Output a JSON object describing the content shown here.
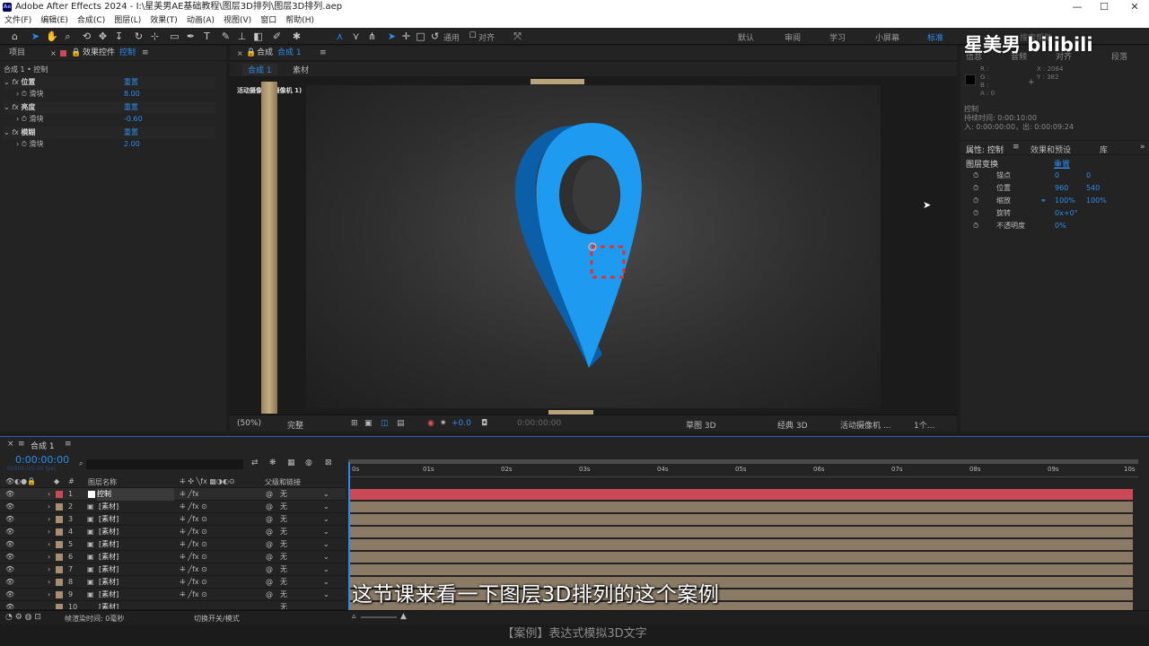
{
  "window": {
    "app_icon": "Ae",
    "title": "Adobe After Effects 2024 - I:\\星美男AE基础教程\\图层3D排列\\图层3D排列.aep",
    "minimize": "—",
    "maximize": "☐",
    "close": "✕"
  },
  "menu": [
    "文件(F)",
    "编辑(E)",
    "合成(C)",
    "图层(L)",
    "效果(T)",
    "动画(A)",
    "视图(V)",
    "窗口",
    "帮助(H)"
  ],
  "toolbar": {
    "align_label": "通用",
    "snap_label": "对齐",
    "workspaces": [
      "默认",
      "审阅",
      "学习",
      "小屏幕",
      "标准"
    ],
    "active_workspace": "标准",
    "search_placeholder": "搜索帮助"
  },
  "left_panel": {
    "tab_project": "项目",
    "tab_effects": "效果控件",
    "tab_effects_target": "控制",
    "breadcrumb": "合成 1 • 控制",
    "effects": [
      {
        "name": "位置",
        "reset": "重置",
        "param": "滑块",
        "value": "8.00"
      },
      {
        "name": "亮度",
        "reset": "重置",
        "param": "滑块",
        "value": "-0.60"
      },
      {
        "name": "模糊",
        "reset": "重置",
        "param": "滑块",
        "value": "2.00"
      }
    ]
  },
  "viewer": {
    "tab_label": "合成",
    "tab_comp": "合成 1",
    "sub_tabs": [
      "合成 1",
      "素材"
    ],
    "camera_label": "活动摄像机 (摄像机 1)",
    "zoom": "(50%)",
    "quality": "完整",
    "exposure": "+0.0",
    "timecode": "0:00:00:00",
    "draft3d": "草图 3D",
    "renderer": "经典 3D",
    "camera_view": "活动摄像机 ...",
    "views": "1个..."
  },
  "right_panel": {
    "info_tabs": [
      "信息",
      "音频",
      "对齐",
      "段落"
    ],
    "rgb": [
      "R :",
      "G :",
      "B :",
      "A : 0"
    ],
    "cursor_x": "X : 2064",
    "cursor_y": "Y : 382",
    "layer_name": "控制",
    "duration": "持续时间: 0:00:10:00",
    "in_out": "入: 0:00:00:00，出: 0:00:09:24",
    "props_tab": "属性: 控制",
    "effects_presets_tab": "效果和预设",
    "library_tab": "库",
    "transform_label": "图层变换",
    "transform_reset": "重置",
    "props": [
      {
        "name": "锚点",
        "v1": "0",
        "v2": "0"
      },
      {
        "name": "位置",
        "v1": "960",
        "v2": "540"
      },
      {
        "name": "缩放",
        "v1": "100%",
        "v2": "100%"
      },
      {
        "name": "旋转",
        "v1": "0x+0°",
        "v2": ""
      },
      {
        "name": "不透明度",
        "v1": "0%",
        "v2": ""
      }
    ]
  },
  "timeline": {
    "tab": "合成 1",
    "timecode": "0:00:00:00",
    "timecode_sub": "00000 (25.00 fps)",
    "search_placeholder": "",
    "col_num": "#",
    "col_name": "图层名称",
    "col_parent": "父级和链接",
    "ruler": [
      "0s",
      "01s",
      "02s",
      "03s",
      "04s",
      "05s",
      "06s",
      "07s",
      "08s",
      "09s",
      "10s"
    ],
    "layers": [
      {
        "num": "1",
        "name": "控制",
        "parent": "无",
        "color": "#c94a55"
      },
      {
        "num": "2",
        "name": "[素材]",
        "parent": "无",
        "color": "#a88f72"
      },
      {
        "num": "3",
        "name": "[素材]",
        "parent": "无",
        "color": "#a88f72"
      },
      {
        "num": "4",
        "name": "[素材]",
        "parent": "无",
        "color": "#a88f72"
      },
      {
        "num": "5",
        "name": "[素材]",
        "parent": "无",
        "color": "#a88f72"
      },
      {
        "num": "6",
        "name": "[素材]",
        "parent": "无",
        "color": "#a88f72"
      },
      {
        "num": "7",
        "name": "[素材]",
        "parent": "无",
        "color": "#a88f72"
      },
      {
        "num": "8",
        "name": "[素材]",
        "parent": "无",
        "color": "#a88f72"
      },
      {
        "num": "9",
        "name": "[素材]",
        "parent": "无",
        "color": "#a88f72"
      },
      {
        "num": "10",
        "name": "[素材]",
        "parent": "无",
        "color": "#a88f72"
      }
    ],
    "render_time": "帧渲染时间: 0毫秒",
    "toggle_label": "切换开关/模式"
  },
  "overlay": {
    "subtitle": "这节课来看一下图层3D排列的这个案例",
    "watermark": "星美男 bilibili",
    "bottom_caption": "【案例】表达式模拟3D文字"
  },
  "colors": {
    "accent": "#2d8ceb",
    "pin_blue": "#1e9bf0",
    "pin_dark": "#0b5ea8",
    "layer_red": "#c94a55",
    "layer_tan": "#a88f72"
  }
}
